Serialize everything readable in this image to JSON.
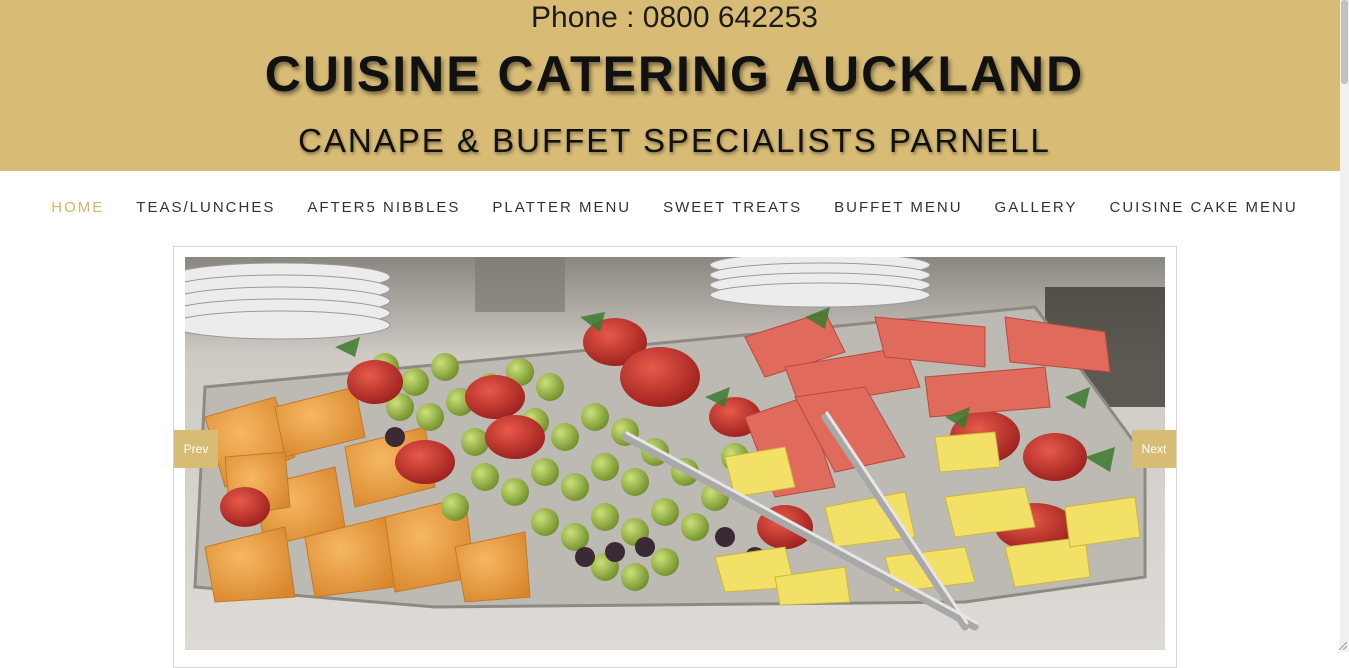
{
  "header": {
    "phone": "Phone : 0800 642253",
    "title": "CUISINE CATERING AUCKLAND",
    "tagline": "CANAPE & BUFFET SPECIALISTS PARNELL"
  },
  "nav": {
    "items": [
      {
        "label": "HOME",
        "active": true
      },
      {
        "label": "TEAS/LUNCHES"
      },
      {
        "label": "AFTER5 NIBBLES"
      },
      {
        "label": "PLATTER MENU"
      },
      {
        "label": "SWEET TREATS"
      },
      {
        "label": "BUFFET MENU"
      },
      {
        "label": "GALLERY"
      },
      {
        "label": "CUISINE CAKE MENU"
      }
    ]
  },
  "slider": {
    "prev_label": "Prev",
    "next_label": "Next"
  },
  "colors": {
    "accent": "#d8bc76",
    "nav_active": "#d6b56c",
    "text": "#333333"
  }
}
